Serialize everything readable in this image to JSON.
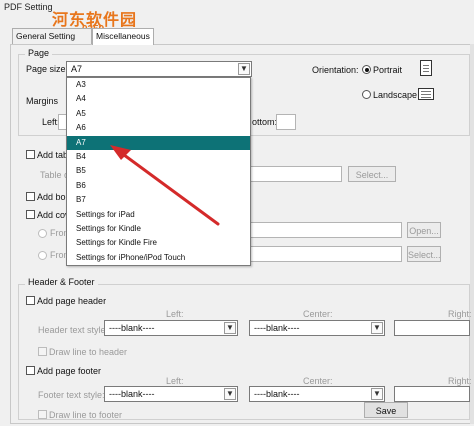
{
  "window": {
    "title": "PDF Setting"
  },
  "watermark": {
    "text": "河东软件园",
    "url": "0359"
  },
  "tabs": [
    {
      "label": "General Setting"
    },
    {
      "label": "Miscellaneous"
    }
  ],
  "page_group": {
    "title": "Page",
    "page_size_label": "Page size:",
    "page_size_value": "A7",
    "orientation_label": "Orientation:",
    "portrait_label": "Portrait",
    "landscape_label": "Landscape",
    "orientation_selected": "Portrait",
    "margins_label": "Margins",
    "left_label": "Left:",
    "bottom_label": "ottom:"
  },
  "page_size_options": [
    "A3",
    "A4",
    "A5",
    "A6",
    "A7",
    "B4",
    "B5",
    "B6",
    "B7",
    "Settings for iPad",
    "Settings for Kindle",
    "Settings for Kindle Fire",
    "Settings for iPhone/iPod Touch"
  ],
  "selected_option": "A7",
  "options_section": {
    "add_table_label": "Add tab",
    "table_label": "Table c",
    "select_button_1": "Select...",
    "add_bookmark_label": "Add  bo",
    "add_cover_label": "Add  cov",
    "from_label_1": "From",
    "from_label_2": "From",
    "open_button": "Open...",
    "select_button_2": "Select..."
  },
  "header_footer": {
    "title": "Header & Footer",
    "add_header_label": "Add page header",
    "left_col": "Left:",
    "center_col": "Center:",
    "right_col": "Right:",
    "header_style_label": "Header text style:",
    "header_left_value": "----blank----",
    "header_center_value": "----blank----",
    "draw_line_header": "Draw line to header",
    "add_footer_label": "Add page footer",
    "footer_style_label": "Footer text style:",
    "footer_left_value": "----blank----",
    "footer_center_value": "----blank----",
    "draw_line_footer": "Draw line to footer"
  },
  "save_button": "Save",
  "colors": {
    "selection": "#0d7276",
    "annotation_arrow": "#d42a2a",
    "watermark": "#e8761c"
  }
}
